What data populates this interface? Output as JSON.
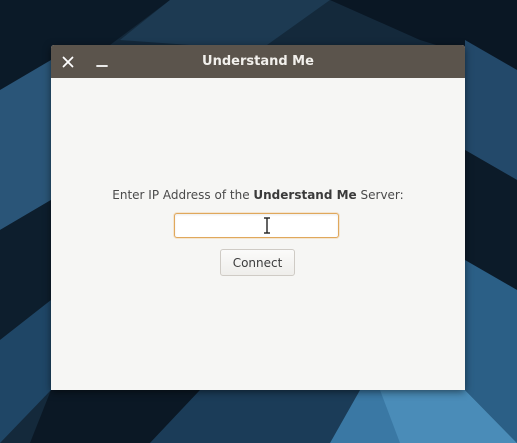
{
  "window": {
    "title": "Understand Me",
    "close_icon": "close-icon",
    "minimize_icon": "minimize-icon"
  },
  "form": {
    "prompt_prefix": "Enter IP Address of the ",
    "prompt_bold": "Understand Me",
    "prompt_suffix": " Server:",
    "ip_value": "",
    "connect_label": "Connect"
  },
  "colors": {
    "titlebar": "#5b544c",
    "window_bg": "#f6f6f4",
    "input_focus_border": "#e0a85c",
    "desktop_bg": "#0f2233"
  }
}
